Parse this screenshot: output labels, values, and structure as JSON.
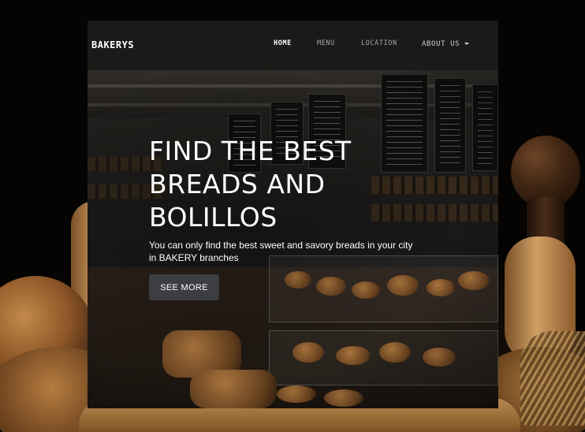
{
  "brand": {
    "name": "BAKERYS"
  },
  "nav": {
    "home": "HOME",
    "menu": "MENU",
    "location": "LOCATION",
    "about": "ABOUT US",
    "active": "HOME"
  },
  "hero": {
    "title_lines": [
      "FIND THE BEST",
      "BREADS AND",
      "BOLILLOS"
    ],
    "subtitle_lines": [
      "You can only find the best sweet and savory breads in your city",
      "in BAKERY branches"
    ],
    "cta_label": "SEE MORE"
  },
  "icons": {
    "about_dropdown": "caret-down-icon"
  },
  "colors": {
    "navbar_bg": "#1b1a19",
    "nav_active": "#ffffff",
    "nav_inactive": "#a9a6a2",
    "cta_bg": "#3c3e42",
    "page_bg": "#050403"
  }
}
